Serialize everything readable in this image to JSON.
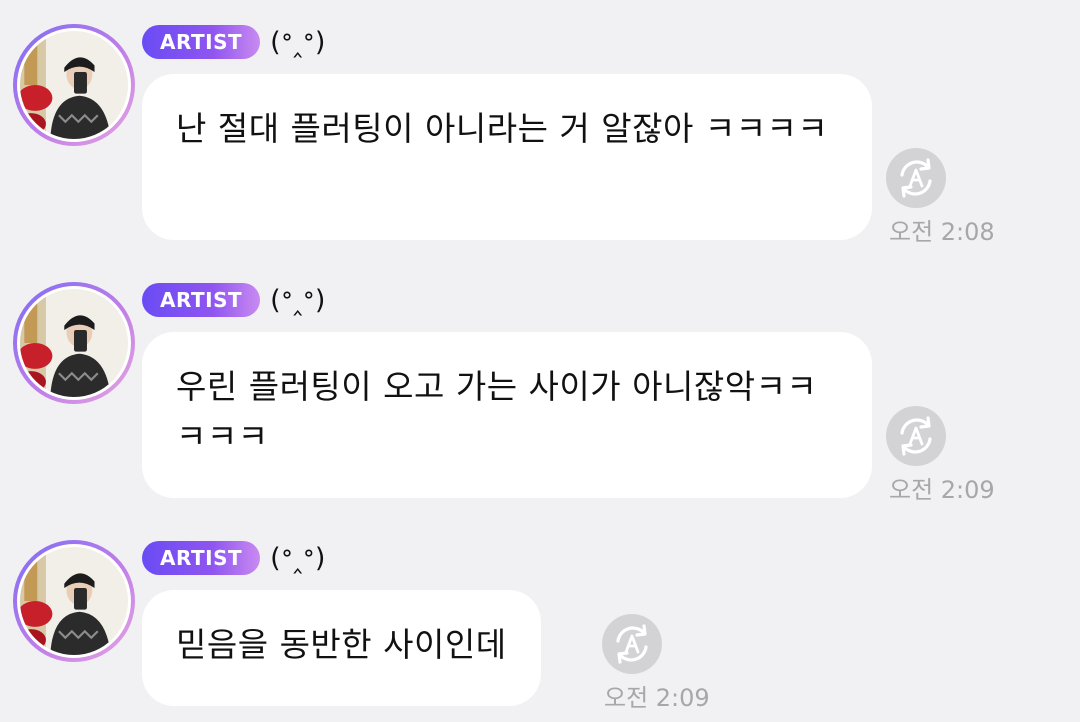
{
  "messages": [
    {
      "badge": "ARTIST",
      "nickname": "(ᐤ‸ᐤ)",
      "text": "난 절대 플러팅이 아니라는 거 알잖아 ㅋㅋㅋㅋ",
      "time": "오전 2:08",
      "translate_icon": "translate-icon"
    },
    {
      "badge": "ARTIST",
      "nickname": "(ᐤ‸ᐤ)",
      "text": "우린 플러팅이 오고 가는 사이가 아니잖악ㅋㅋㅋㅋㅋ",
      "time": "오전 2:09",
      "translate_icon": "translate-icon"
    },
    {
      "badge": "ARTIST",
      "nickname": "(ᐤ‸ᐤ)",
      "text": "믿음을 동반한 사이인데",
      "time": "오전 2:09",
      "translate_icon": "translate-icon"
    }
  ],
  "colors": {
    "background": "#f1f1f3",
    "bubble": "#ffffff",
    "badge_start": "#6a4cf4",
    "badge_end": "#c98af0",
    "timestamp": "#a7a7ab"
  }
}
